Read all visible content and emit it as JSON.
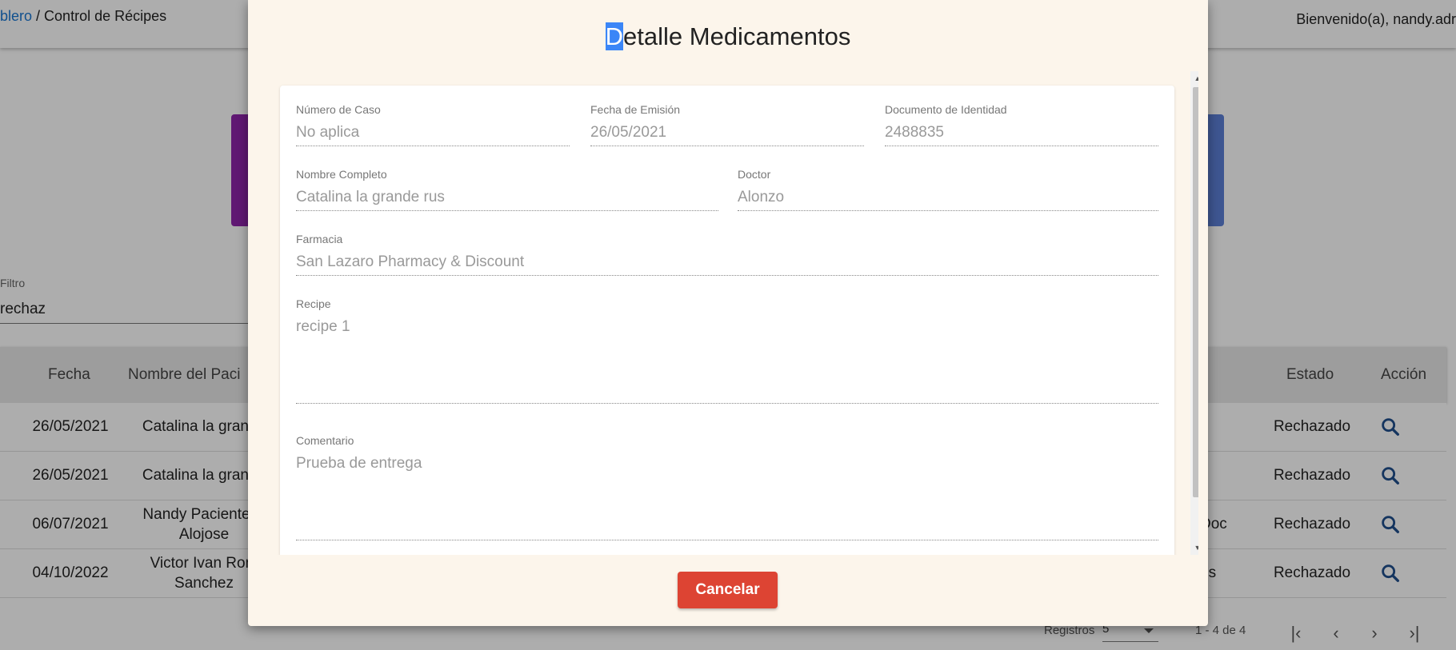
{
  "header": {
    "breadcrumb_link": "blero",
    "breadcrumb_sep": " / ",
    "breadcrumb_current": "Control de Récipes",
    "welcome": "Bienvenido(a), nandy.adr"
  },
  "filter": {
    "label": "Filtro",
    "value": "rechaz"
  },
  "table": {
    "headers": {
      "fecha": "Fecha",
      "paciente": "Nombre del Paci",
      "estado": "Estado",
      "accion": "Acción"
    },
    "rows": [
      {
        "fecha": "26/05/2021",
        "name1": "Catalina la grande",
        "name2": "",
        "doc": "",
        "estado": "Rechazado"
      },
      {
        "fecha": "26/05/2021",
        "name1": "Catalina la grande",
        "name2": "",
        "doc": "",
        "estado": "Rechazado"
      },
      {
        "fecha": "06/07/2021",
        "name1": "Nandy Paciente D",
        "name2": "Alojose",
        "doc": "Doc",
        "estado": "Rechazado"
      },
      {
        "fecha": "04/10/2022",
        "name1": "Victor Ivan Rom",
        "name2": "Sanchez",
        "doc": "es",
        "estado": "Rechazado"
      }
    ]
  },
  "pagination": {
    "label": "Registros",
    "page_size": "5",
    "range": "1 - 4 de 4"
  },
  "dialog": {
    "title_first": "D",
    "title_rest": "etalle Medicamentos",
    "fields": {
      "caso": {
        "label": "Número de Caso",
        "value": "No aplica"
      },
      "fecha": {
        "label": "Fecha de Emisión",
        "value": "26/05/2021"
      },
      "documento": {
        "label": "Documento de Identidad",
        "value": "2488835"
      },
      "nombre": {
        "label": "Nombre Completo",
        "value": "Catalina la grande rus"
      },
      "doctor": {
        "label": "Doctor",
        "value": "Alonzo"
      },
      "farmacia": {
        "label": "Farmacia",
        "value": "San Lazaro Pharmacy & Discount"
      },
      "recipe": {
        "label": "Recipe",
        "value": "recipe 1"
      },
      "comentario": {
        "label": "Comentario",
        "value": "Prueba de entrega"
      }
    },
    "cancel_label": "Cancelar"
  },
  "colors": {
    "dialog_bg": "#fcf5eb",
    "cancel_button": "#dd4433",
    "link": "#1976d2",
    "search_icon": "#1f4e8c",
    "card_purple": "#8e24aa",
    "card_blue": "#5c7fd6"
  },
  "icons": {
    "row_action": "search-icon",
    "pager": [
      "first-page-icon",
      "previous-page-icon",
      "next-page-icon",
      "last-page-icon"
    ]
  }
}
